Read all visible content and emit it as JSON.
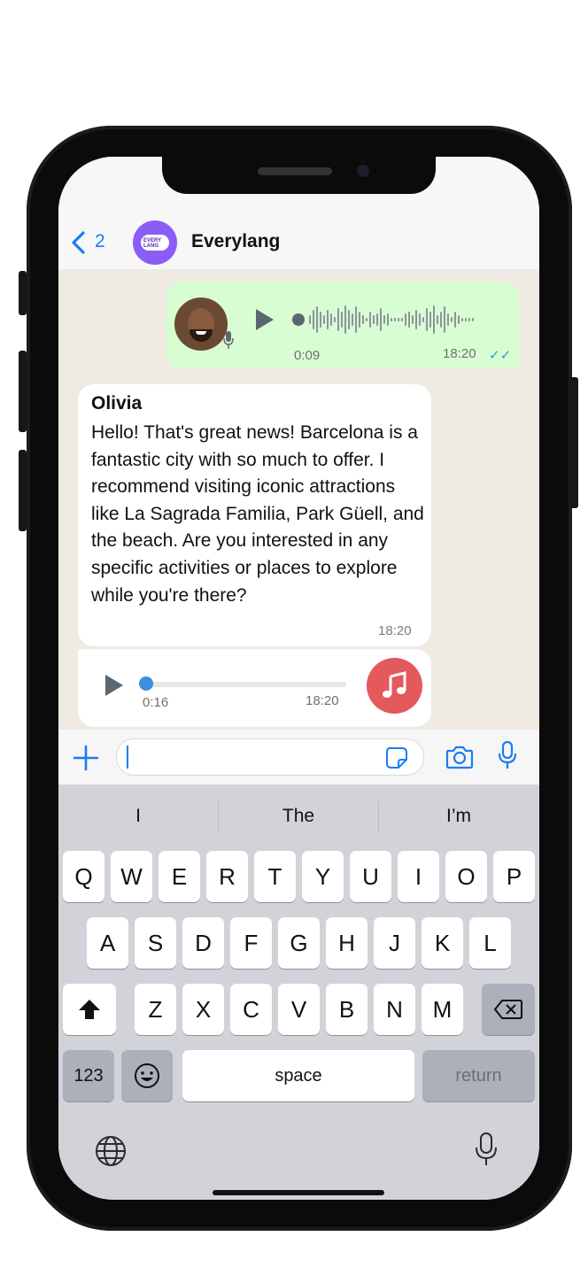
{
  "header": {
    "back_count": "2",
    "chat_name": "Everylang",
    "logo_text": "EVERY LANG"
  },
  "outgoing_voice": {
    "duration": "0:09",
    "time": "18:20",
    "ticks": "✓✓"
  },
  "incoming_message": {
    "sender": "Olivia",
    "text": "Hello! That's great news! Barcelona is a fantastic city with so much to offer. I recommend visiting iconic attractions like La Sagrada Familia, Park Güell, and the beach. Are you interested in any specific activities or places to explore while you're there?",
    "time": "18:20"
  },
  "incoming_audio": {
    "duration": "0:16",
    "time": "18:20",
    "progress": 0.0
  },
  "input": {
    "value": "",
    "placeholder": ""
  },
  "keyboard": {
    "suggestions": [
      "I",
      "The",
      "I’m"
    ],
    "row1": [
      "Q",
      "W",
      "E",
      "R",
      "T",
      "Y",
      "U",
      "I",
      "O",
      "P"
    ],
    "row2": [
      "A",
      "S",
      "D",
      "F",
      "G",
      "H",
      "J",
      "K",
      "L"
    ],
    "row3": [
      "Z",
      "X",
      "C",
      "V",
      "B",
      "N",
      "M"
    ],
    "numbers_key": "123",
    "space_key": "space",
    "return_key": "return"
  },
  "colors": {
    "accent": "#1b7cf5",
    "outgoing_bubble": "#d9fdd3",
    "music": "#e3595c"
  }
}
